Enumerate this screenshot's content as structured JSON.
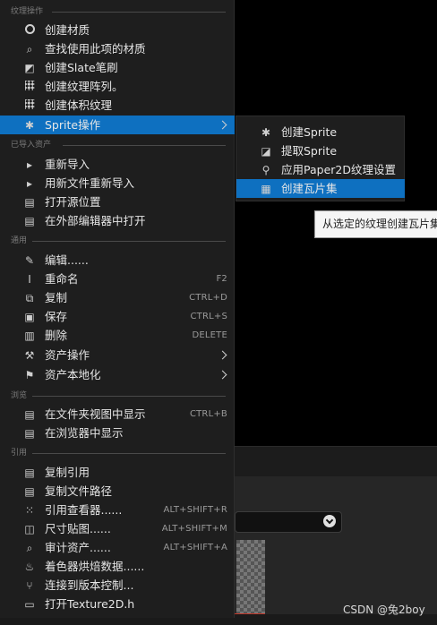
{
  "menu": {
    "sections": [
      {
        "header": "纹理操作",
        "items": [
          {
            "label": "创建材质",
            "icon": "material-sphere-icon"
          },
          {
            "label": "查找使用此项的材质",
            "icon": "search-icon"
          },
          {
            "label": "创建Slate笔刷",
            "icon": "brush-icon"
          },
          {
            "label": "创建纹理阵列。",
            "icon": "texture-array-icon"
          },
          {
            "label": "创建体积纹理",
            "icon": "volume-texture-icon"
          },
          {
            "label": "Sprite操作",
            "icon": "sprite-icon",
            "submenu": true,
            "highlighted": true
          }
        ]
      },
      {
        "header": "已导入资产",
        "items": [
          {
            "label": "重新导入",
            "icon": "reimport-icon"
          },
          {
            "label": "用新文件重新导入",
            "icon": "reimport-file-icon"
          },
          {
            "label": "打开源位置",
            "icon": "folder-open-icon"
          },
          {
            "label": "在外部编辑器中打开",
            "icon": "external-editor-icon"
          }
        ]
      },
      {
        "header": "通用",
        "items": [
          {
            "label": "编辑......",
            "icon": "pencil-icon"
          },
          {
            "label": "重命名",
            "icon": "rename-icon",
            "shortcut": "F2"
          },
          {
            "label": "复制",
            "icon": "duplicate-icon",
            "shortcut": "CTRL+D"
          },
          {
            "label": "保存",
            "icon": "save-icon",
            "shortcut": "CTRL+S"
          },
          {
            "label": "删除",
            "icon": "trash-icon",
            "shortcut": "DELETE"
          },
          {
            "label": "资产操作",
            "icon": "wrench-icon",
            "submenu": true
          },
          {
            "label": "资产本地化",
            "icon": "flag-icon",
            "submenu": true
          }
        ]
      },
      {
        "header": "浏览",
        "items": [
          {
            "label": "在文件夹视图中显示",
            "icon": "folder-icon",
            "shortcut": "CTRL+B"
          },
          {
            "label": "在浏览器中显示",
            "icon": "browser-folder-icon"
          }
        ]
      },
      {
        "header": "引用",
        "items": [
          {
            "label": "复制引用",
            "icon": "copy-icon"
          },
          {
            "label": "复制文件路径",
            "icon": "copy-path-icon"
          },
          {
            "label": "引用查看器......",
            "icon": "reference-viewer-icon",
            "shortcut": "ALT+SHIFT+R"
          },
          {
            "label": "尺寸贴图......",
            "icon": "size-map-icon",
            "shortcut": "ALT+SHIFT+M"
          },
          {
            "label": "审计资产......",
            "icon": "audit-icon",
            "shortcut": "ALT+SHIFT+A"
          },
          {
            "label": "着色器烘焙数据......",
            "icon": "shader-bake-icon"
          },
          {
            "label": "连接到版本控制...",
            "icon": "source-control-icon"
          },
          {
            "label": "打开Texture2D.h",
            "icon": "code-file-icon"
          }
        ]
      }
    ]
  },
  "submenu": {
    "items": [
      {
        "label": "创建Sprite",
        "icon": "create-sprite-icon"
      },
      {
        "label": "提取Sprite",
        "icon": "extract-sprite-icon"
      },
      {
        "label": "应用Paper2D纹理设置",
        "icon": "paper2d-settings-icon"
      },
      {
        "label": "创建瓦片集",
        "icon": "tileset-icon",
        "highlighted": true
      }
    ]
  },
  "tooltip": {
    "text": "从选定的纹理创建瓦片集"
  },
  "watermark": {
    "text": "CSDN @兔2boy"
  },
  "colors": {
    "menu_bg": "#1e1e1e",
    "highlight": "#0e70c0",
    "tooltip_bg": "#f5f5f5"
  }
}
